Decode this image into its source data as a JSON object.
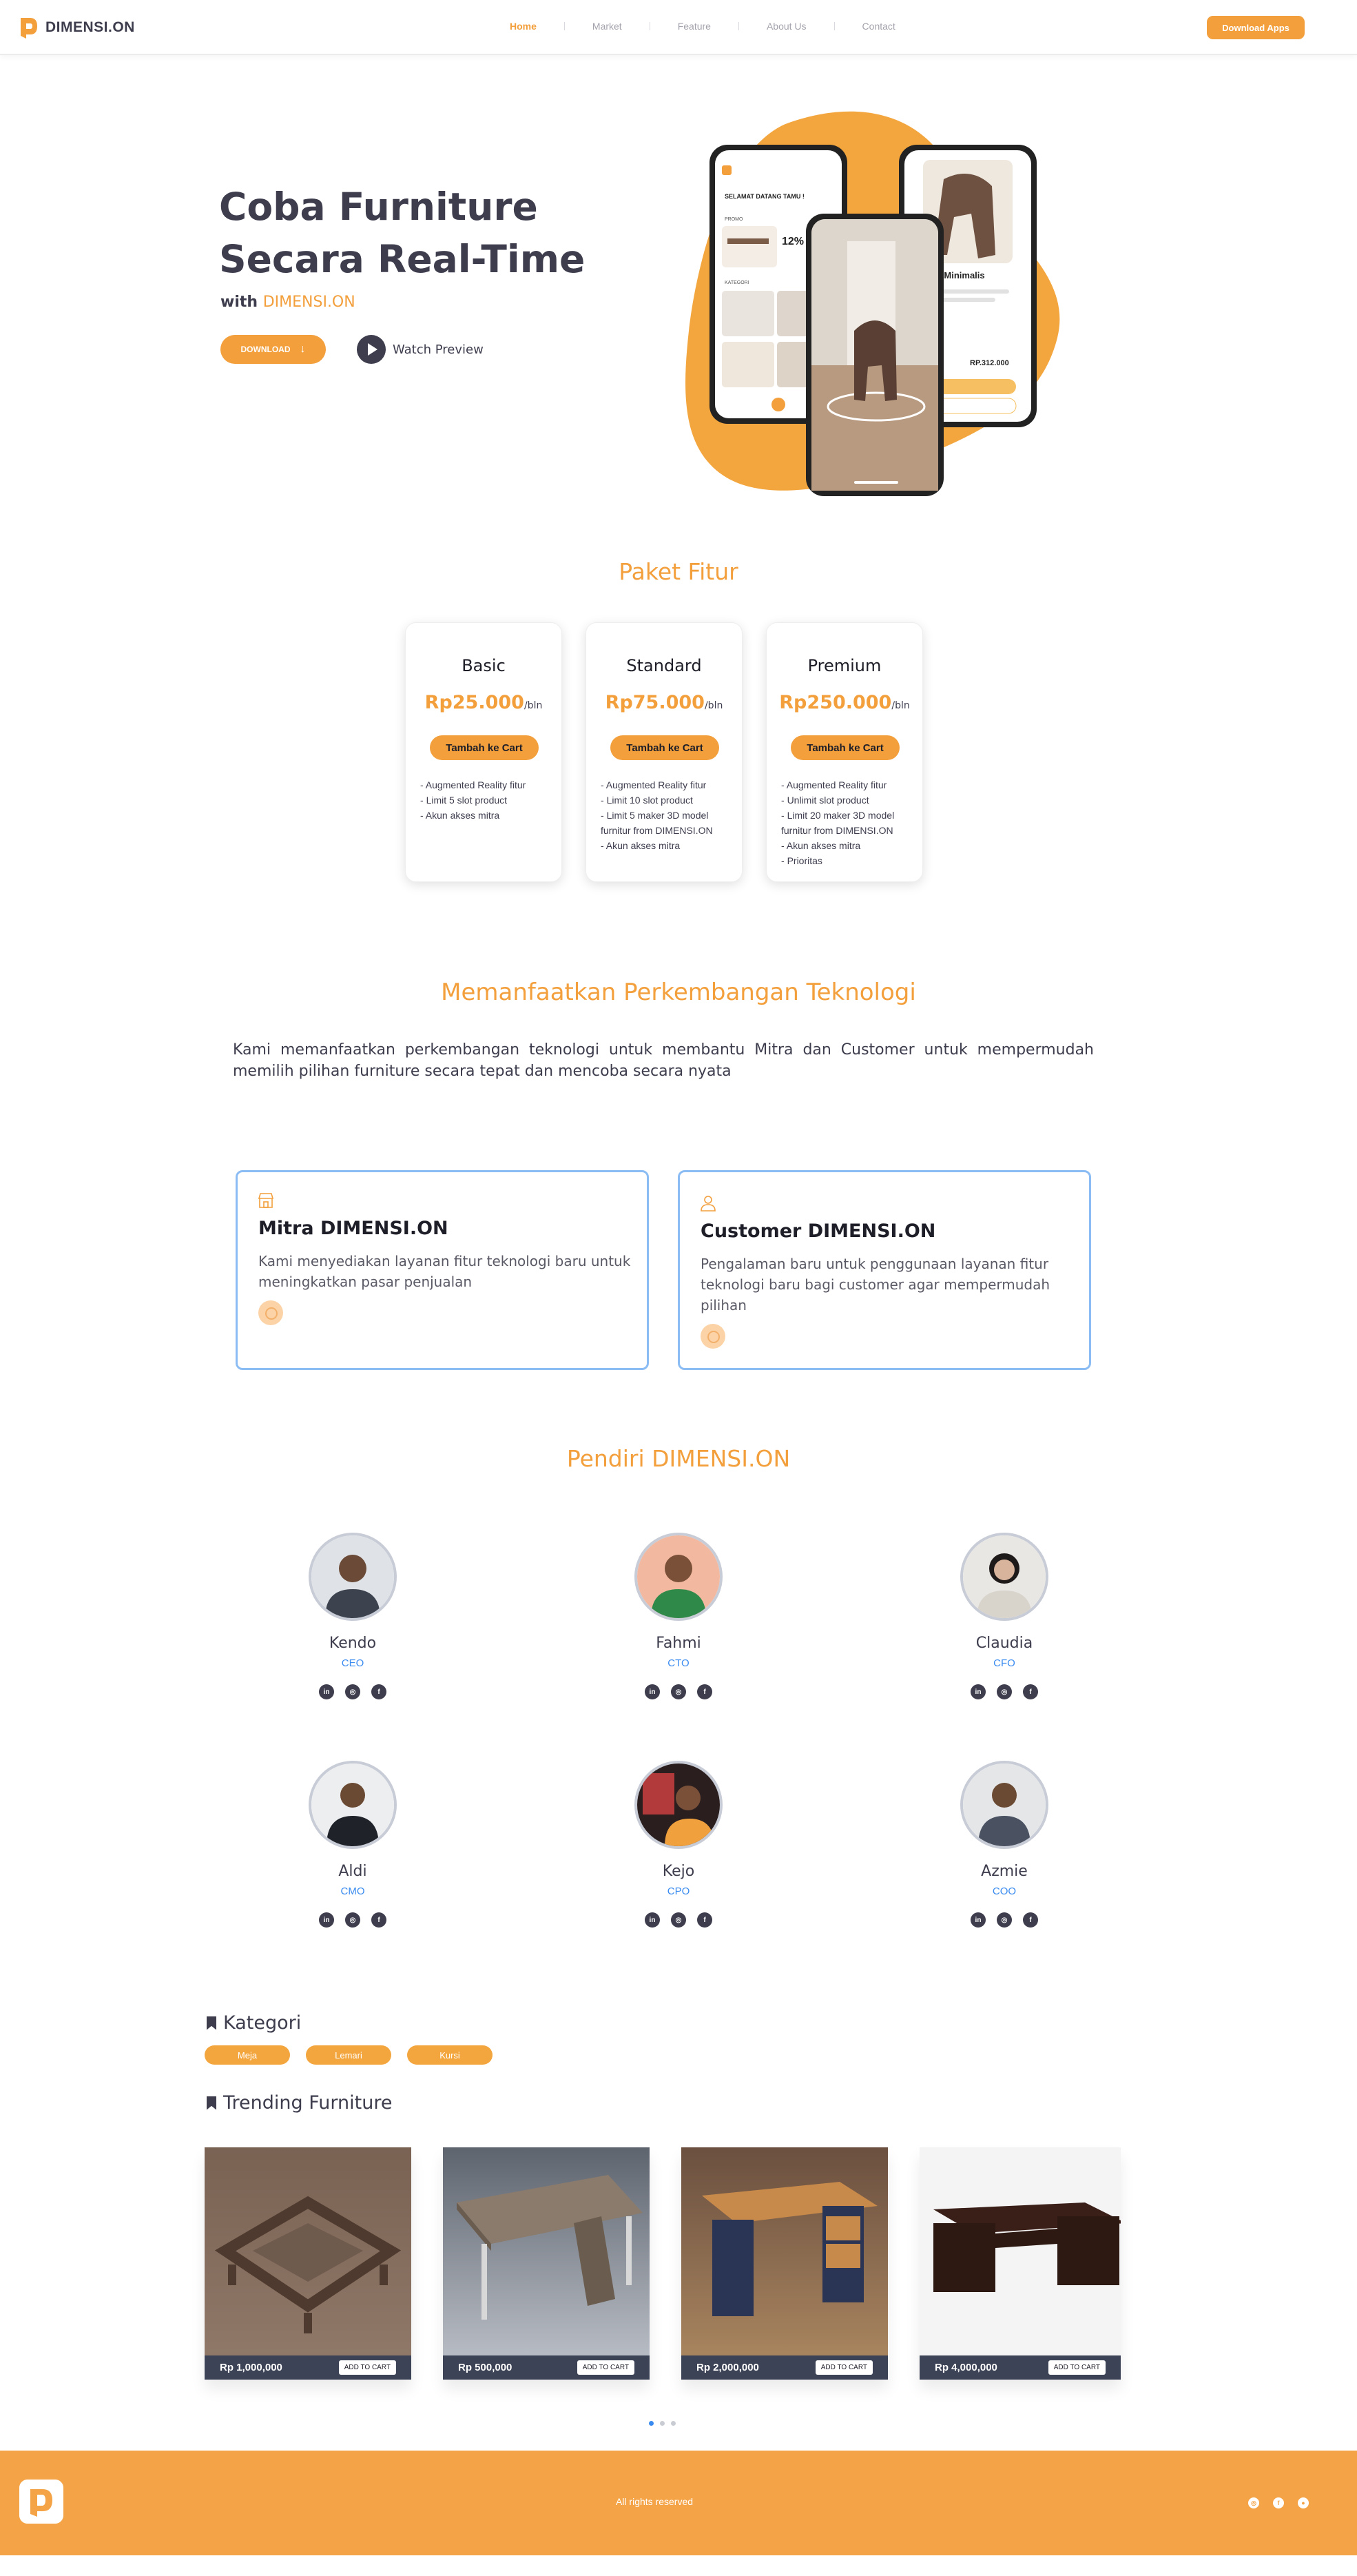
{
  "nav": {
    "brand": "DIMENSI.ON",
    "items": [
      {
        "label": "Home",
        "active": true
      },
      {
        "label": "Market",
        "active": false
      },
      {
        "label": "Feature",
        "active": false
      },
      {
        "label": "About Us",
        "active": false
      },
      {
        "label": "Contact",
        "active": false
      }
    ],
    "download_label": "Download Apps"
  },
  "hero": {
    "title_line1": "Coba Furniture",
    "title_line2": "Secara Real-Time",
    "subtitle_prefix": "with",
    "subtitle_brand": "DIMENSI.ON",
    "download_label": "DOWNLOAD",
    "watch_label": "Watch Preview",
    "phone_text": {
      "welcome": "SELAMAT DATANG TAMU !",
      "promo": "PROMO",
      "percent": "12%",
      "kategori": "KATEGORI",
      "product": "Kayu Minimalis",
      "price": "RP.312.000"
    }
  },
  "pricing": {
    "title": "Paket Fitur",
    "plans": [
      {
        "name": "Basic",
        "price": "Rp25.000",
        "per": "/bln",
        "cta": "Tambah ke Cart",
        "features": [
          "Augmented Reality fitur",
          "Limit 5 slot product",
          "Akun akses mitra"
        ]
      },
      {
        "name": "Standard",
        "price": "Rp75.000",
        "per": "/bln",
        "cta": "Tambah ke Cart",
        "features": [
          "Augmented Reality fitur",
          "Limit 10 slot product",
          "Limit 5 maker 3D model furnitur from DIMENSI.ON",
          "Akun akses mitra"
        ]
      },
      {
        "name": "Premium",
        "price": "Rp250.000",
        "per": "/bln",
        "cta": "Tambah ke Cart",
        "features": [
          "Augmented Reality fitur",
          "Unlimit slot product",
          "Limit 20 maker 3D model furnitur from DIMENSI.ON",
          "Akun akses mitra",
          "Prioritas"
        ]
      }
    ]
  },
  "tech": {
    "title": "Memanfaatkan Perkembangan Teknologi",
    "body": "Kami memanfaatkan perkembangan teknologi untuk membantu Mitra dan Customer untuk mempermudah memilih pilihan furniture secara tepat dan mencoba secara nyata",
    "cards": [
      {
        "title": "Mitra DIMENSI.ON",
        "text": "Kami menyediakan layanan fitur teknologi baru untuk meningkatkan pasar penjualan"
      },
      {
        "title": "Customer DIMENSI.ON",
        "text": "Pengalaman baru untuk penggunaan layanan fitur teknologi baru bagi customer agar mempermudah pilihan"
      }
    ]
  },
  "team": {
    "title": "Pendiri DIMENSI.ON",
    "members": [
      {
        "name": "Kendo",
        "role": "CEO"
      },
      {
        "name": "Fahmi",
        "role": "CTO"
      },
      {
        "name": "Claudia",
        "role": "CFO"
      },
      {
        "name": "Aldi",
        "role": "CMO"
      },
      {
        "name": "Kejo",
        "role": "CPO"
      },
      {
        "name": "Azmie",
        "role": "COO"
      }
    ]
  },
  "kategori": {
    "title": "Kategori",
    "items": [
      "Meja",
      "Lemari",
      "Kursi"
    ]
  },
  "trending": {
    "title": "Trending Furniture",
    "cart_label": "ADD TO CART",
    "products": [
      {
        "price": "Rp 1,000,000"
      },
      {
        "price": "Rp 500,000"
      },
      {
        "price": "Rp 2,000,000"
      },
      {
        "price": "Rp 4,000,000"
      }
    ]
  },
  "footer": {
    "rights": "All rights reserved"
  },
  "colors": {
    "accent": "#f29f3c",
    "dark": "#3d3d4e",
    "link_blue": "#3a8bf0",
    "card_border": "#8bbcf3"
  }
}
